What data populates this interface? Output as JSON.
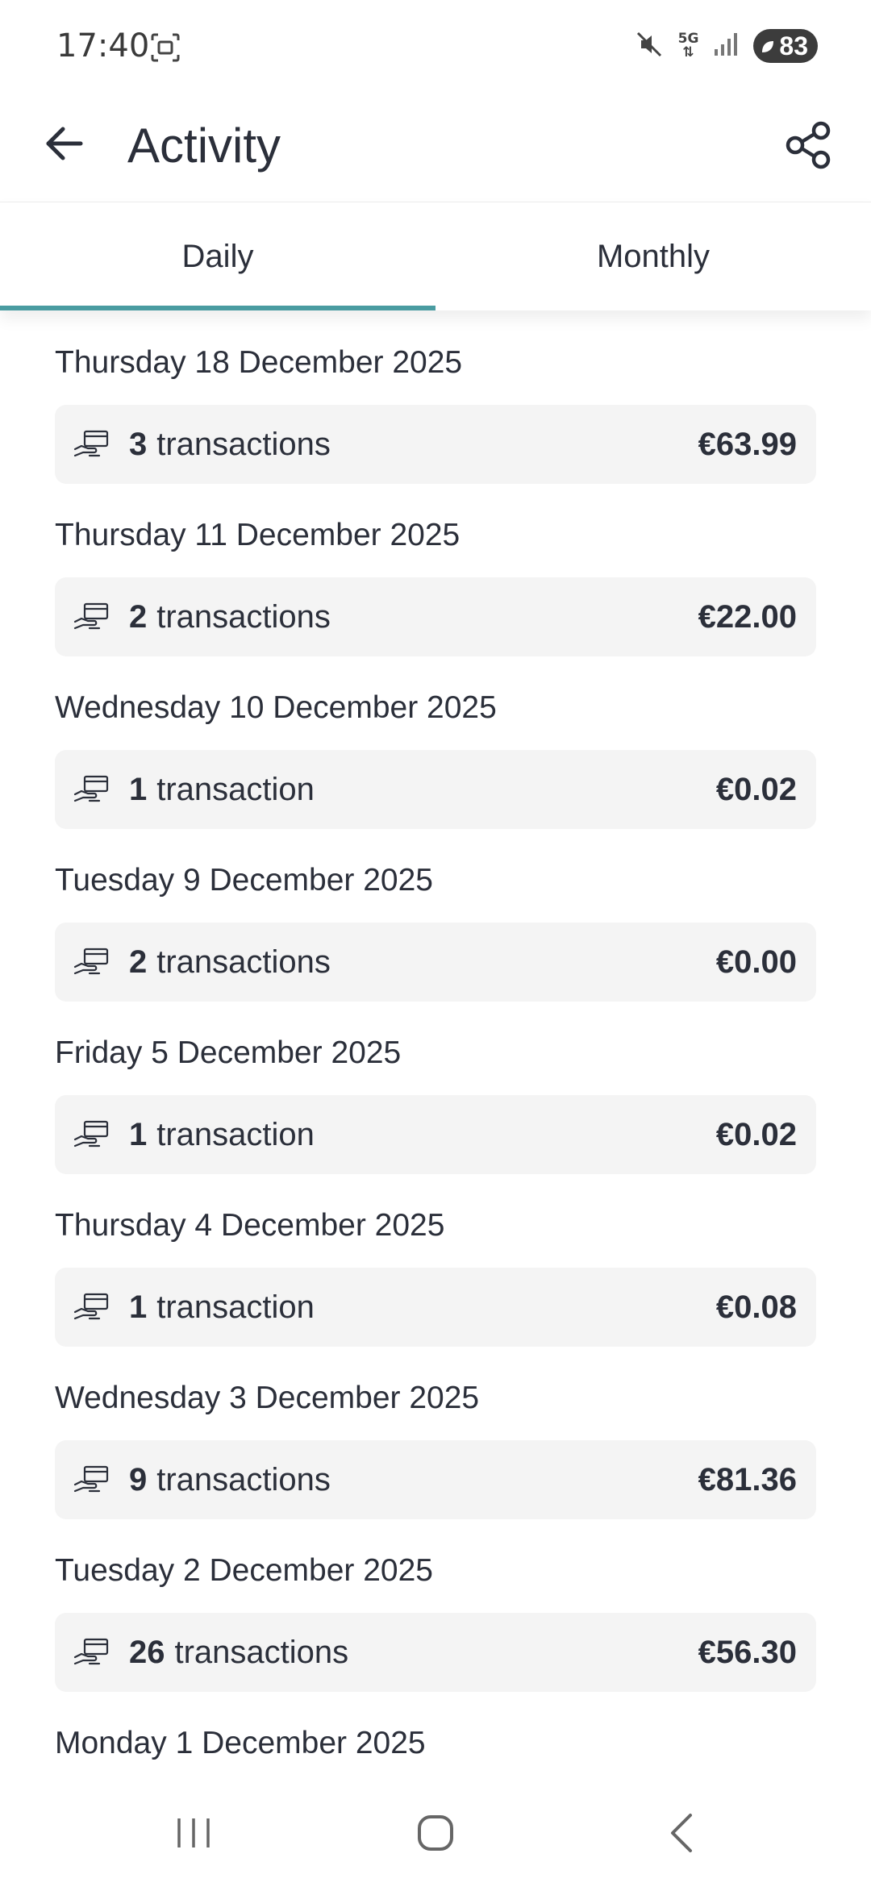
{
  "status_bar": {
    "time": "17:40",
    "network": "5G",
    "battery": "83"
  },
  "header": {
    "title": "Activity"
  },
  "tabs": [
    {
      "label": "Daily",
      "active": true
    },
    {
      "label": "Monthly",
      "active": false
    }
  ],
  "days": [
    {
      "date": "Thursday 18 December 2025",
      "count": "3",
      "label": "transactions",
      "amount": "€63.99"
    },
    {
      "date": "Thursday 11 December 2025",
      "count": "2",
      "label": "transactions",
      "amount": "€22.00"
    },
    {
      "date": "Wednesday 10 December 2025",
      "count": "1",
      "label": "transaction",
      "amount": "€0.02"
    },
    {
      "date": "Tuesday 9 December 2025",
      "count": "2",
      "label": "transactions",
      "amount": "€0.00"
    },
    {
      "date": "Friday 5 December 2025",
      "count": "1",
      "label": "transaction",
      "amount": "€0.02"
    },
    {
      "date": "Thursday 4 December 2025",
      "count": "1",
      "label": "transaction",
      "amount": "€0.08"
    },
    {
      "date": "Wednesday 3 December 2025",
      "count": "9",
      "label": "transactions",
      "amount": "€81.36"
    },
    {
      "date": "Tuesday 2 December 2025",
      "count": "26",
      "label": "transactions",
      "amount": "€56.30"
    },
    {
      "date": "Monday 1 December 2025"
    }
  ],
  "colors": {
    "accent": "#4a9ca1",
    "card_bg": "#f4f4f4",
    "text": "#2b2f3a"
  },
  "icons": {
    "back": "arrow-left-icon",
    "share": "share-icon",
    "card": "hand-card-icon"
  }
}
